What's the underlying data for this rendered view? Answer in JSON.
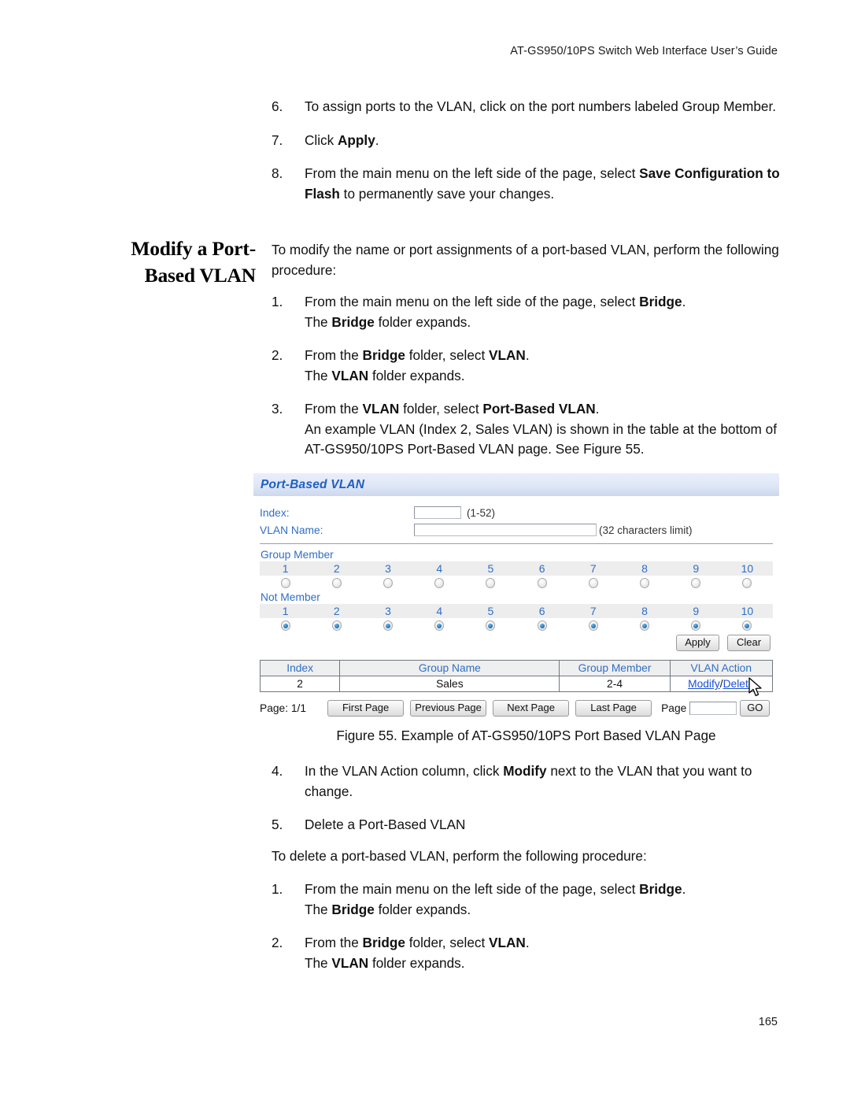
{
  "header": {
    "running_title": "AT-GS950/10PS Switch Web Interface User’s Guide"
  },
  "footer": {
    "page_number": "165"
  },
  "top_steps": [
    {
      "num": "6.",
      "html": "To assign ports to the VLAN, click on the port numbers labeled Group Member."
    },
    {
      "num": "7.",
      "html": "Click <b>Apply</b>."
    },
    {
      "num": "8.",
      "html": "From the main menu on the left side of the page, select <b>Save Configuration to Flash</b> to permanently save your changes."
    }
  ],
  "section": {
    "heading_line1": "Modify a Port-",
    "heading_line2": "Based VLAN",
    "intro": "To modify the name or port assignments of a port-based VLAN, perform the following procedure:",
    "steps": [
      {
        "num": "1.",
        "html": "From the main menu on the left side of the page, select <b>Bridge</b>.<br>The <b>Bridge</b> folder expands."
      },
      {
        "num": "2.",
        "html": "From the <b>Bridge</b> folder, select <b>VLAN</b>.<br>The <b>VLAN</b> folder expands."
      },
      {
        "num": "3.",
        "html": "From the <b>VLAN</b> folder, select <b>Port-Based VLAN</b>.<br>An example VLAN (Index 2, Sales VLAN) is shown in the table at the bottom of AT-GS950/10PS Port-Based VLAN page. See Figure 55."
      }
    ]
  },
  "figure": {
    "caption": "Figure 55. Example of AT-GS950/10PS Port Based VLAN Page",
    "ui": {
      "title": "Port-Based VLAN",
      "index_label": "Index:",
      "index_value": "",
      "index_hint": "(1-52)",
      "vlan_name_label": "VLAN Name:",
      "vlan_name_value": "",
      "vlan_name_hint": "(32 characters limit)",
      "group_member_label": "Group Member",
      "not_member_label": "Not Member",
      "ports": [
        "1",
        "2",
        "3",
        "4",
        "5",
        "6",
        "7",
        "8",
        "9",
        "10"
      ],
      "group_member_selected": [
        false,
        false,
        false,
        false,
        false,
        false,
        false,
        false,
        false,
        false
      ],
      "not_member_selected": [
        true,
        true,
        true,
        true,
        true,
        true,
        true,
        true,
        true,
        true
      ],
      "apply_label": "Apply",
      "clear_label": "Clear",
      "table": {
        "columns": [
          "Index",
          "Group Name",
          "Group Member",
          "VLAN Action"
        ],
        "rows": [
          {
            "index": "2",
            "group_name": "Sales",
            "group_member": "2-4",
            "action_modify": "Modify",
            "action_sep": "/",
            "action_delete": "Delete"
          }
        ]
      },
      "pager": {
        "page_status": "Page: 1/1",
        "first_page": "First Page",
        "previous_page": "Previous Page",
        "next_page": "Next Page",
        "last_page": "Last Page",
        "page_label": "Page",
        "page_input_value": "",
        "go_label": "GO"
      },
      "colors": {
        "link_blue": "#2f6fc4",
        "title_blue": "#1f5fbf",
        "action_link": "#1b4fd6",
        "header_band": "#dfe7f7",
        "row_band": "#ededed"
      }
    }
  },
  "after_steps": [
    {
      "num": "4.",
      "html": "In the VLAN Action column, click <b>Modify</b> next to the VLAN that you want to change."
    },
    {
      "num": "5.",
      "html": "Delete a Port-Based VLAN"
    }
  ],
  "delete_section": {
    "intro": "To delete a port-based VLAN, perform the following procedure:",
    "steps": [
      {
        "num": "1.",
        "html": "From the main menu on the left side of the page, select <b>Bridge</b>.<br>The <b>Bridge</b> folder expands."
      },
      {
        "num": "2.",
        "html": "From the <b>Bridge</b> folder, select <b>VLAN</b>.<br>The <b>VLAN</b> folder expands."
      }
    ]
  }
}
